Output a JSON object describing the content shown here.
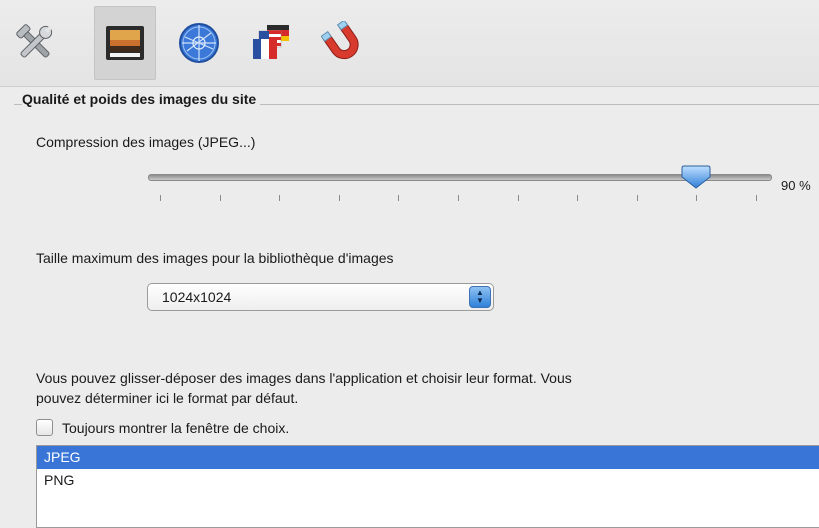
{
  "toolbar": {
    "items": [
      {
        "icon": "tools-icon"
      },
      {
        "icon": "image-icon",
        "selected": true
      },
      {
        "icon": "globe-icon"
      },
      {
        "icon": "flags-icon"
      },
      {
        "icon": "magnet-icon"
      }
    ]
  },
  "group": {
    "title": "Qualité et poids des images du site"
  },
  "compression": {
    "label": "Compression des images (JPEG...)",
    "value_percent": 90,
    "value_text": "90 %",
    "tick_count": 11
  },
  "max_size": {
    "label": "Taille maximum des images pour la bibliothèque d'images",
    "selected": "1024x1024"
  },
  "drag_info": {
    "line1": "Vous pouvez glisser-déposer des images dans l'application et choisir leur format. Vous",
    "line2": "pouvez déterminer ici le format par défaut."
  },
  "always_show": {
    "label": "Toujours montrer la fenêtre de choix.",
    "checked": false
  },
  "formats": {
    "items": [
      "JPEG",
      "PNG"
    ],
    "selected_index": 0
  },
  "colors": {
    "selection": "#3875d7",
    "thumb": "#5a9be6"
  }
}
